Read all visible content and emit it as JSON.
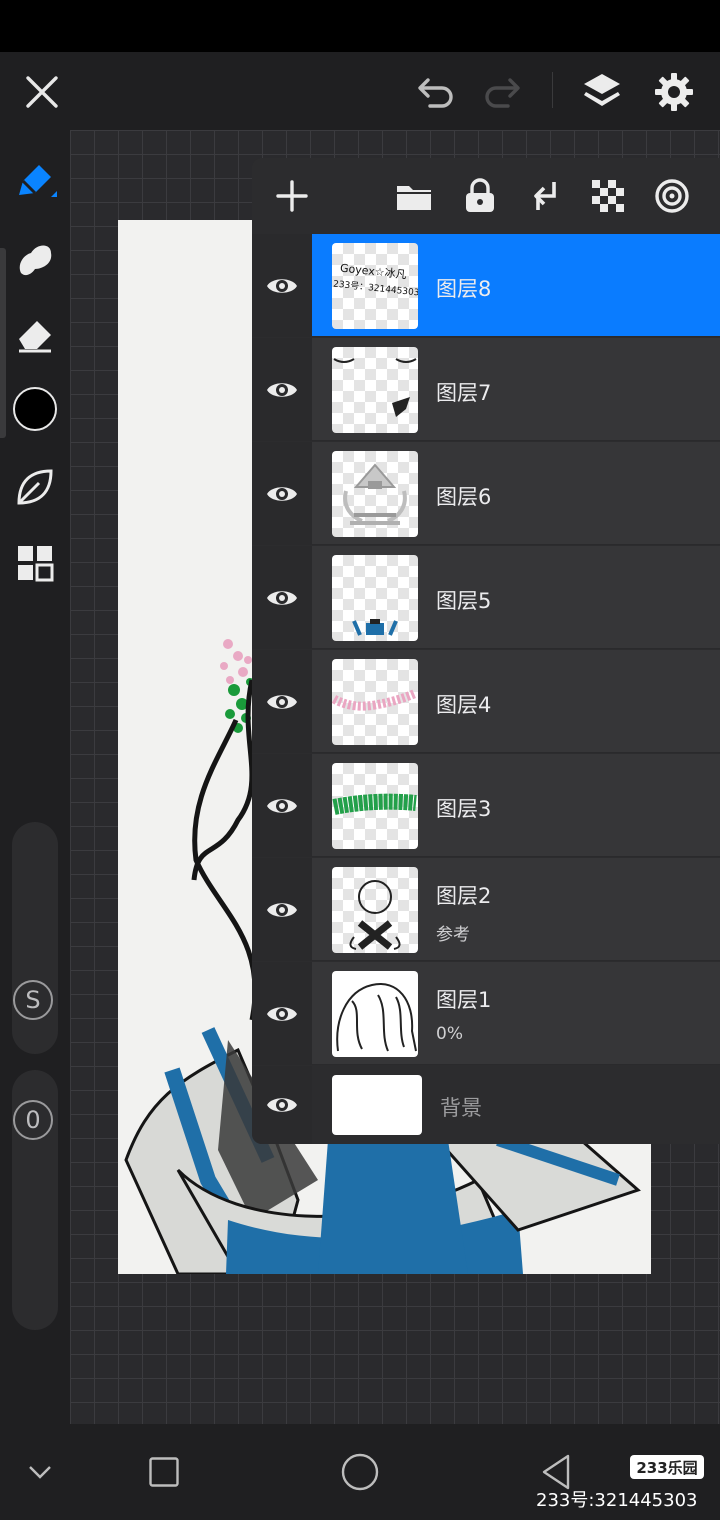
{
  "toolbar": {
    "icons": [
      "close-icon",
      "undo-icon",
      "redo-icon",
      "layers-icon",
      "settings-icon"
    ]
  },
  "sidebar": {
    "tools": [
      "pen-icon",
      "smudge-icon",
      "eraser-icon",
      "color-swatch",
      "leaf-icon",
      "grid-icon"
    ],
    "size_label": "S",
    "opacity_label": "0",
    "color": "#000000"
  },
  "layers_panel": {
    "header_icons": [
      "add-icon",
      "folder-icon",
      "lock-icon",
      "merge-down-icon",
      "checker-icon",
      "target-icon"
    ],
    "layers": [
      {
        "name": "图层8",
        "subtitle": "",
        "active": true,
        "visible": true
      },
      {
        "name": "图层7",
        "subtitle": "",
        "active": false,
        "visible": true
      },
      {
        "name": "图层6",
        "subtitle": "",
        "active": false,
        "visible": true
      },
      {
        "name": "图层5",
        "subtitle": "",
        "active": false,
        "visible": true
      },
      {
        "name": "图层4",
        "subtitle": "",
        "active": false,
        "visible": true
      },
      {
        "name": "图层3",
        "subtitle": "",
        "active": false,
        "visible": true
      },
      {
        "name": "图层2",
        "subtitle": "参考",
        "active": false,
        "visible": true
      },
      {
        "name": "图层1",
        "subtitle": "0%",
        "active": false,
        "visible": true
      }
    ],
    "background": {
      "name": "背景",
      "visible": true
    },
    "thumb_text": {
      "line1": "Goyex☆冰凡",
      "line2": "233号：321445303"
    }
  },
  "navbar": {
    "icons": [
      "chevron-down-icon",
      "recents-icon",
      "home-icon",
      "back-icon"
    ]
  },
  "watermark": {
    "badge": "233乐园",
    "text": "233号:321445303"
  },
  "colors": {
    "accent": "#0a7cff",
    "panel": "#2c2c2e",
    "toolbar": "#1f1f21"
  }
}
